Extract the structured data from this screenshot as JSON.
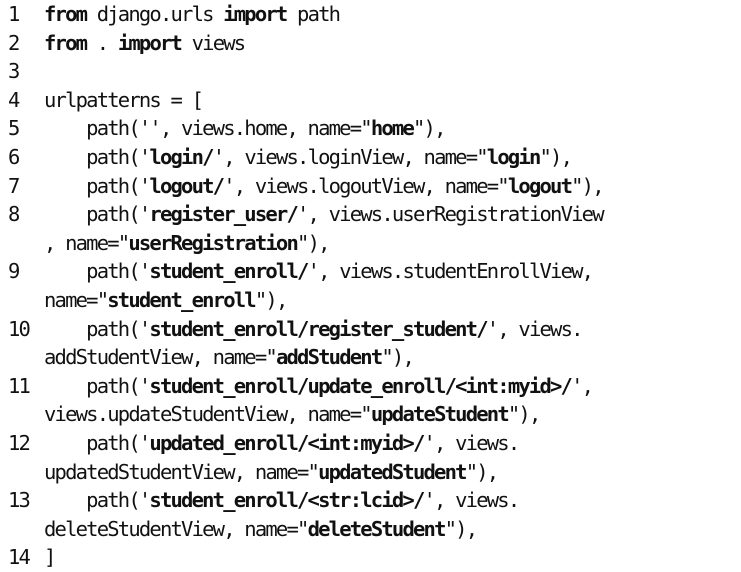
{
  "code": {
    "lines": [
      {
        "number": "1",
        "segments": [
          {
            "t": "from",
            "b": true
          },
          {
            "t": " django.urls "
          },
          {
            "t": "import",
            "b": true
          },
          {
            "t": " path"
          }
        ]
      },
      {
        "number": "2",
        "segments": [
          {
            "t": "from",
            "b": true
          },
          {
            "t": " . "
          },
          {
            "t": "import",
            "b": true
          },
          {
            "t": " views"
          }
        ]
      },
      {
        "number": "3",
        "segments": []
      },
      {
        "number": "4",
        "segments": [
          {
            "t": "urlpatterns = ["
          }
        ]
      },
      {
        "number": "5",
        "segments": [
          {
            "t": "    path('', views.home, name=\""
          },
          {
            "t": "home",
            "b": true
          },
          {
            "t": "\"),"
          }
        ]
      },
      {
        "number": "6",
        "segments": [
          {
            "t": "    path('"
          },
          {
            "t": "login/",
            "b": true
          },
          {
            "t": "', views.loginView, name=\""
          },
          {
            "t": "login",
            "b": true
          },
          {
            "t": "\"),"
          }
        ]
      },
      {
        "number": "7",
        "segments": [
          {
            "t": "    path('"
          },
          {
            "t": "logout/",
            "b": true
          },
          {
            "t": "', views.logoutView, name=\""
          },
          {
            "t": "logout",
            "b": true
          },
          {
            "t": "\"),"
          }
        ]
      },
      {
        "number": "8",
        "segments": [
          {
            "t": "    path('"
          },
          {
            "t": "register_user/",
            "b": true
          },
          {
            "t": "', views.userRegistrationView"
          }
        ]
      },
      {
        "number": "",
        "segments": [
          {
            "t": ", name=\""
          },
          {
            "t": "userRegistration",
            "b": true
          },
          {
            "t": "\"),"
          }
        ]
      },
      {
        "number": "9",
        "segments": [
          {
            "t": "    path('"
          },
          {
            "t": "student_enroll/",
            "b": true
          },
          {
            "t": "', views.studentEnrollView,"
          }
        ]
      },
      {
        "number": "",
        "segments": [
          {
            "t": "name=\""
          },
          {
            "t": "student_enroll",
            "b": true
          },
          {
            "t": "\"),"
          }
        ]
      },
      {
        "number": "10",
        "segments": [
          {
            "t": "    path('"
          },
          {
            "t": "student_enroll/register_student/",
            "b": true
          },
          {
            "t": "', views."
          }
        ]
      },
      {
        "number": "",
        "segments": [
          {
            "t": "addStudentView, name=\""
          },
          {
            "t": "addStudent",
            "b": true
          },
          {
            "t": "\"),"
          }
        ]
      },
      {
        "number": "11",
        "segments": [
          {
            "t": "    path('"
          },
          {
            "t": "student_enroll/update_enroll/<int:myid>/",
            "b": true
          },
          {
            "t": "',"
          }
        ]
      },
      {
        "number": "",
        "segments": [
          {
            "t": "views.updateStudentView, name=\""
          },
          {
            "t": "updateStudent",
            "b": true
          },
          {
            "t": "\"),"
          }
        ]
      },
      {
        "number": "12",
        "segments": [
          {
            "t": "    path('"
          },
          {
            "t": "updated_enroll/<int:myid>/",
            "b": true
          },
          {
            "t": "', views."
          }
        ]
      },
      {
        "number": "",
        "segments": [
          {
            "t": "updatedStudentView, name=\""
          },
          {
            "t": "updatedStudent",
            "b": true
          },
          {
            "t": "\"),"
          }
        ]
      },
      {
        "number": "13",
        "segments": [
          {
            "t": "    path('"
          },
          {
            "t": "student_enroll/<str:lcid>/",
            "b": true
          },
          {
            "t": "', views."
          }
        ]
      },
      {
        "number": "",
        "segments": [
          {
            "t": "deleteStudentView, name=\""
          },
          {
            "t": "deleteStudent",
            "b": true
          },
          {
            "t": "\"),"
          }
        ]
      },
      {
        "number": "14",
        "segments": [
          {
            "t": "]"
          }
        ]
      }
    ]
  }
}
